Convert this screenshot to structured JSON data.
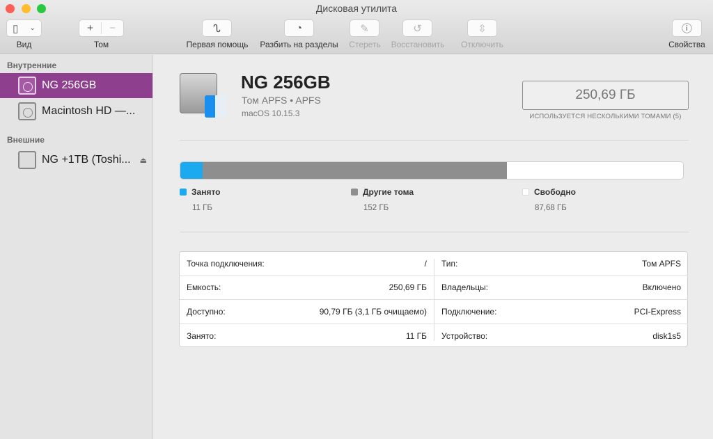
{
  "window": {
    "title": "Дисковая утилита"
  },
  "toolbar": {
    "view": "Вид",
    "volume": "Том",
    "first_aid": "Первая помощь",
    "partition": "Разбить на разделы",
    "erase": "Стереть",
    "restore": "Восстановить",
    "unmount": "Отключить",
    "info": "Свойства"
  },
  "sidebar": {
    "internal_header": "Внутренние",
    "internal": [
      {
        "label": "NG 256GB",
        "selected": true
      },
      {
        "label": "Macintosh HD —..."
      }
    ],
    "external_header": "Внешние",
    "external": [
      {
        "label": "NG +1TB (Toshi..."
      }
    ]
  },
  "volume": {
    "name": "NG 256GB",
    "type_line": "Том APFS • APFS",
    "os": "macOS 10.15.3",
    "capacity": "250,69 ГБ",
    "capacity_note": "ИСПОЛЬЗУЕТСЯ НЕСКОЛЬКИМИ ТОМАМИ (5)"
  },
  "usage": {
    "total_gb": 250.69,
    "segments": [
      {
        "label": "Занято",
        "value": "11 ГБ",
        "gb": 11,
        "color": "#1ba9f0"
      },
      {
        "label": "Другие тома",
        "value": "152 ГБ",
        "gb": 152,
        "color": "#8e8e8e"
      },
      {
        "label": "Свободно",
        "value": "87,68 ГБ",
        "gb": 87.68,
        "color": "#ffffff"
      }
    ]
  },
  "info": {
    "left": [
      {
        "k": "Точка подключения:",
        "v": "/"
      },
      {
        "k": "Емкость:",
        "v": "250,69 ГБ"
      },
      {
        "k": "Доступно:",
        "v": "90,79 ГБ (3,1 ГБ очищаемо)"
      },
      {
        "k": "Занято:",
        "v": "11 ГБ"
      }
    ],
    "right": [
      {
        "k": "Тип:",
        "v": "Том APFS"
      },
      {
        "k": "Владельцы:",
        "v": "Включено"
      },
      {
        "k": "Подключение:",
        "v": "PCI-Express"
      },
      {
        "k": "Устройство:",
        "v": "disk1s5"
      }
    ]
  },
  "colors": {
    "selection": "#8e3f8e",
    "used": "#1ba9f0",
    "other": "#8e8e8e"
  }
}
